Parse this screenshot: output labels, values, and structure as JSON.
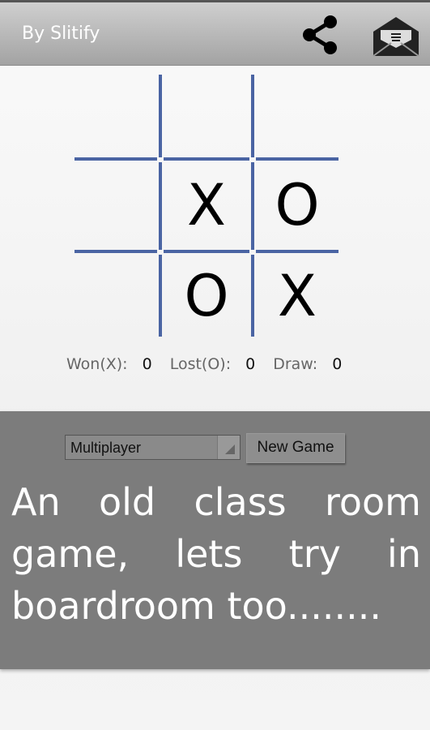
{
  "header": {
    "title": "By Slitify",
    "share_icon": "share-icon",
    "mail_icon": "envelope-open-icon"
  },
  "board": {
    "cells": [
      "",
      "",
      "",
      "",
      "X",
      "O",
      "",
      "O",
      "X"
    ],
    "line_color": "#4a64a3"
  },
  "stats": {
    "won_label": "Won(X):",
    "won": "0",
    "lost_label": "Lost(O):",
    "lost": "0",
    "draw_label": "Draw:",
    "draw": "0"
  },
  "controls": {
    "mode": "Multiplayer",
    "new_game": "New Game"
  },
  "message": "An old class room game, lets try in boardroom too........"
}
